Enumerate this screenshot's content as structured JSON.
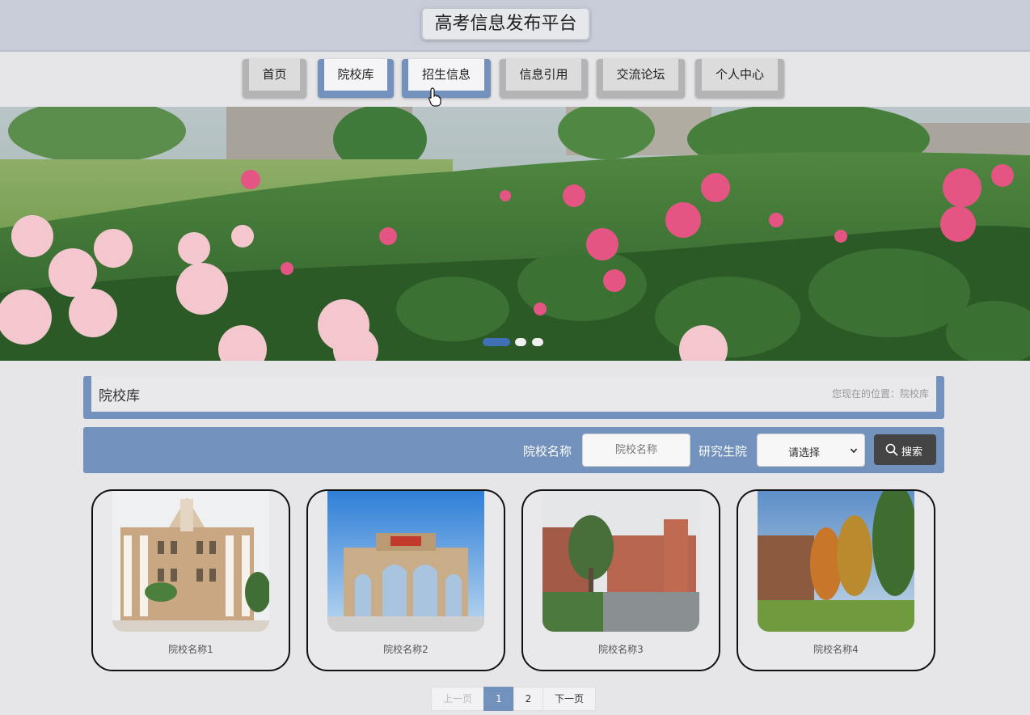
{
  "header": {
    "title": "高考信息发布平台"
  },
  "nav": {
    "items": [
      {
        "label": "首页",
        "active": false
      },
      {
        "label": "院校库",
        "active": true
      },
      {
        "label": "招生信息",
        "active": true
      },
      {
        "label": "信息引用",
        "active": false
      },
      {
        "label": "交流论坛",
        "active": false
      },
      {
        "label": "个人中心",
        "active": false
      }
    ]
  },
  "banner": {
    "slide_count": 3,
    "active_slide": 1
  },
  "section": {
    "title": "院校库",
    "breadcrumb": "您现在的位置：院校库"
  },
  "search": {
    "name_label": "院校名称",
    "name_placeholder": "院校名称",
    "grad_label": "研究生院",
    "grad_selected": "请选择",
    "button_label": "搜索",
    "button_icon": "search-icon"
  },
  "schools": [
    {
      "name": "院校名称1"
    },
    {
      "name": "院校名称2"
    },
    {
      "name": "院校名称3"
    },
    {
      "name": "院校名称4"
    }
  ],
  "pagination": {
    "prev": "上一页",
    "pages": [
      "1",
      "2"
    ],
    "current": "1",
    "next": "下一页"
  },
  "colors": {
    "accent": "#7391bd",
    "header_bg": "#c7ccd8",
    "page_bg": "#e6e6e9",
    "button_dark": "#444444"
  }
}
